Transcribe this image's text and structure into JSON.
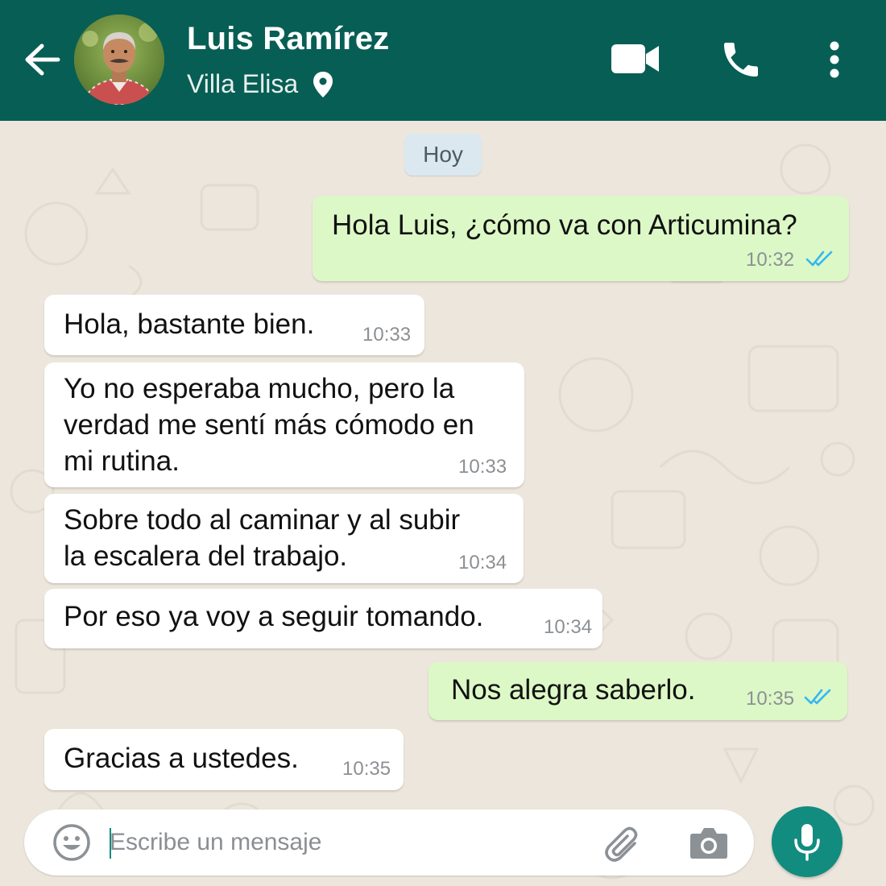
{
  "header": {
    "contact_name": "Luis Ramírez",
    "contact_status": "Villa Elisa",
    "background_color": "#075e54",
    "icons": [
      "back-arrow-icon",
      "location-pin-icon",
      "video-call-icon",
      "phone-call-icon",
      "more-options-icon"
    ]
  },
  "chat": {
    "date_separator": "Hoy",
    "messages": [
      {
        "direction": "outgoing",
        "text": "Hola Luis, ¿cómo va con Articumina?",
        "time": "10:32",
        "status": "read"
      },
      {
        "direction": "incoming",
        "text": "Hola, bastante bien.",
        "time": "10:33"
      },
      {
        "direction": "incoming",
        "text": "Yo no esperaba mucho, pero la\nverdad me sentí más cómodo en\nmi rutina.",
        "time": "10:33"
      },
      {
        "direction": "incoming",
        "text": "Sobre todo al caminar y al subir\nla escalera del trabajo.",
        "time": "10:34"
      },
      {
        "direction": "incoming",
        "text": "Por eso ya voy a seguir tomando.",
        "time": "10:34"
      },
      {
        "direction": "outgoing",
        "text": "Nos alegra saberlo.",
        "time": "10:35",
        "status": "read"
      },
      {
        "direction": "incoming",
        "text": "Gracias a ustedes.",
        "time": "10:35"
      }
    ],
    "outgoing_bubble_color": "#dcf8c6",
    "incoming_bubble_color": "#ffffff",
    "read_tick_color": "#34b7f1"
  },
  "composer": {
    "placeholder": "Escribe un mensaje",
    "value": "",
    "icons": [
      "emoji-icon",
      "attach-clip-icon",
      "camera-icon",
      "microphone-icon"
    ],
    "mic_button_color": "#128c7e"
  }
}
